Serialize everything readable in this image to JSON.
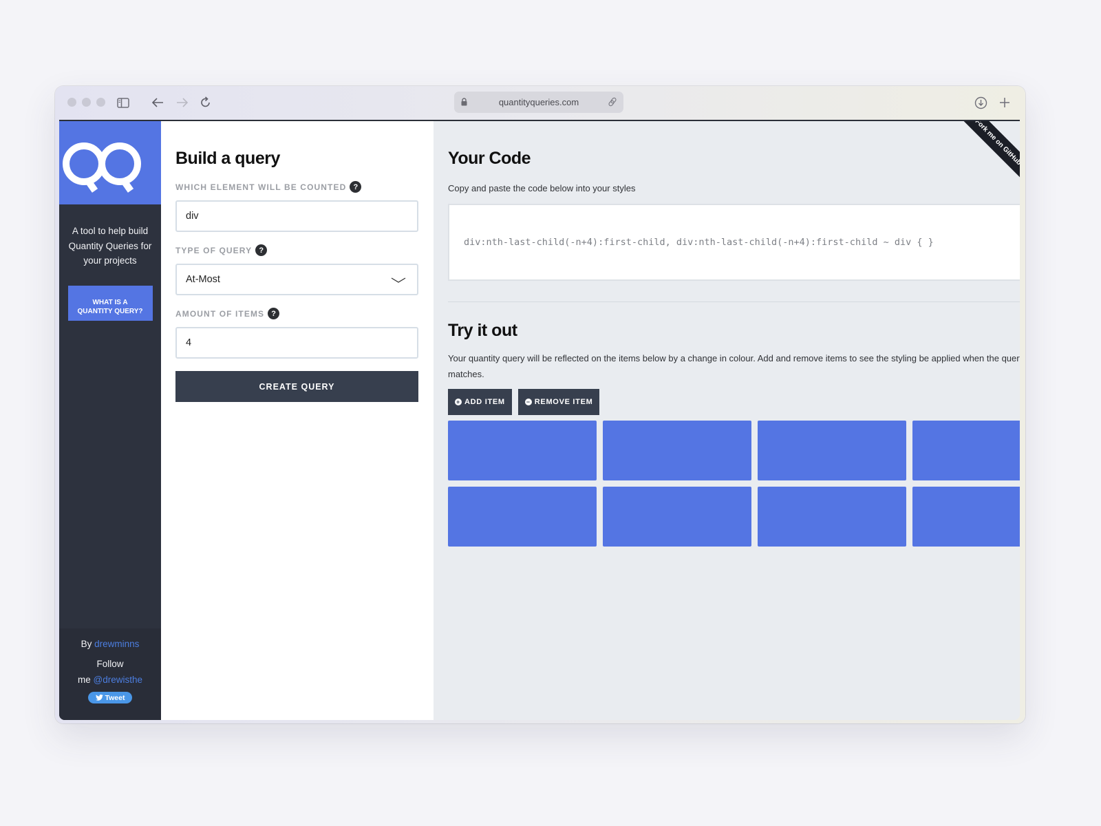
{
  "browser": {
    "url": "quantityqueries.com",
    "icons": [
      "sidebar-toggle-icon",
      "back-arrow-icon",
      "forward-arrow-icon",
      "reload-icon",
      "lock-icon",
      "link-icon",
      "download-icon",
      "new-tab-icon"
    ]
  },
  "sidebar": {
    "logo_text": "QQ",
    "tagline": "A tool to help build Quantity Queries for your projects",
    "what_button_line1": "WHAT IS A",
    "what_button_line2": "QUANTITY QUERY?",
    "by_label": "By",
    "author_link": "drewminns",
    "follow_label_1": "Follow",
    "follow_label_2": "me",
    "twitter_handle": "@drewisthe",
    "tweet_button": "Tweet",
    "accent_color": "#5475e3"
  },
  "build": {
    "title": "Build a query",
    "element_label": "WHICH ELEMENT WILL BE COUNTED",
    "element_value": "div",
    "type_label": "TYPE OF QUERY",
    "type_value": "At-Most",
    "amount_label": "AMOUNT OF ITEMS",
    "amount_value": "4",
    "help_glyph": "?",
    "create_button": "CREATE QUERY"
  },
  "code": {
    "title": "Your Code",
    "description": "Copy and paste the code below into your styles",
    "snippet": "div:nth-last-child(-n+4):first-child, div:nth-last-child(-n+4):first-child ~ div { }",
    "ribbon_text": "Fork me on GitHub"
  },
  "try": {
    "title": "Try it out",
    "description": "Your quantity query will be reflected on the items below by a change in colour. Add and remove items to see the styling be applied when the query matches.",
    "add_button": "ADD ITEM",
    "remove_button": "REMOVE ITEM",
    "item_count": 8,
    "item_color": "#5475e3"
  }
}
